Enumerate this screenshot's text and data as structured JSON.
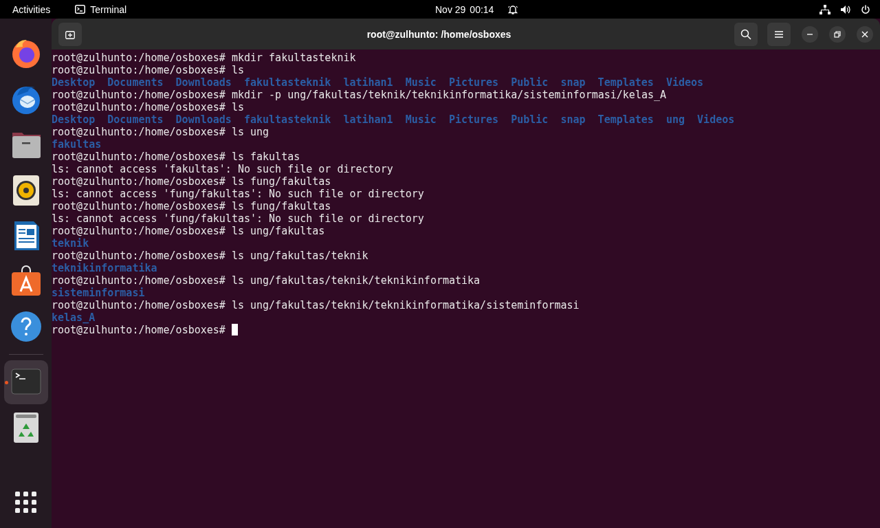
{
  "top_bar": {
    "activities": "Activities",
    "app_name": "Terminal",
    "date": "Nov 29",
    "time": "00:14"
  },
  "dock": {
    "items": [
      {
        "kind": "firefox",
        "selected": false,
        "running": false
      },
      {
        "kind": "thunderbird",
        "selected": false,
        "running": false
      },
      {
        "kind": "files",
        "selected": false,
        "running": false
      },
      {
        "kind": "rhythmbox",
        "selected": false,
        "running": false
      },
      {
        "kind": "writer",
        "selected": false,
        "running": false
      },
      {
        "kind": "appstore",
        "selected": false,
        "running": false
      },
      {
        "kind": "help",
        "selected": false,
        "running": false
      },
      {
        "kind": "terminal",
        "selected": true,
        "running": true
      },
      {
        "kind": "trash",
        "selected": false,
        "running": false
      }
    ]
  },
  "window": {
    "title": "root@zulhunto: /home/osboxes"
  },
  "terminal": {
    "lines": [
      {
        "kind": "text",
        "text": "root@zulhunto:/home/osboxes# mkdir fakultasteknik"
      },
      {
        "kind": "text",
        "text": "root@zulhunto:/home/osboxes# ls"
      },
      {
        "kind": "listing",
        "items": [
          "Desktop",
          "Documents",
          "Downloads",
          "fakultasteknik",
          "latihan1",
          "Music",
          "Pictures",
          "Public",
          "snap",
          "Templates",
          "Videos"
        ]
      },
      {
        "kind": "text",
        "text": "root@zulhunto:/home/osboxes# mkdir -p ung/fakultas/teknik/teknikinformatika/sisteminformasi/kelas_A"
      },
      {
        "kind": "text",
        "text": "root@zulhunto:/home/osboxes# ls"
      },
      {
        "kind": "listing",
        "items": [
          "Desktop",
          "Documents",
          "Downloads",
          "fakultasteknik",
          "latihan1",
          "Music",
          "Pictures",
          "Public",
          "snap",
          "Templates",
          "ung",
          "Videos"
        ]
      },
      {
        "kind": "text",
        "text": "root@zulhunto:/home/osboxes# ls ung"
      },
      {
        "kind": "listing",
        "items": [
          "fakultas"
        ]
      },
      {
        "kind": "text",
        "text": "root@zulhunto:/home/osboxes# ls fakultas"
      },
      {
        "kind": "text",
        "text": "ls: cannot access 'fakultas': No such file or directory"
      },
      {
        "kind": "text",
        "text": "root@zulhunto:/home/osboxes# ls fung/fakultas"
      },
      {
        "kind": "text",
        "text": "ls: cannot access 'fung/fakultas': No such file or directory"
      },
      {
        "kind": "text",
        "text": "root@zulhunto:/home/osboxes# ls fung/fakultas"
      },
      {
        "kind": "text",
        "text": "ls: cannot access 'fung/fakultas': No such file or directory"
      },
      {
        "kind": "text",
        "text": "root@zulhunto:/home/osboxes# ls ung/fakultas"
      },
      {
        "kind": "listing",
        "items": [
          "teknik"
        ]
      },
      {
        "kind": "text",
        "text": "root@zulhunto:/home/osboxes# ls ung/fakultas/teknik"
      },
      {
        "kind": "listing",
        "items": [
          "teknikinformatika"
        ]
      },
      {
        "kind": "text",
        "text": "root@zulhunto:/home/osboxes# ls ung/fakultas/teknik/teknikinformatika"
      },
      {
        "kind": "listing",
        "items": [
          "sisteminformasi"
        ]
      },
      {
        "kind": "text",
        "text": "root@zulhunto:/home/osboxes# ls ung/fakultas/teknik/teknikinformatika/sisteminformasi"
      },
      {
        "kind": "listing",
        "items": [
          "kelas_A"
        ]
      },
      {
        "kind": "prompt",
        "text": "root@zulhunto:/home/osboxes#",
        "cursor": true
      }
    ]
  }
}
